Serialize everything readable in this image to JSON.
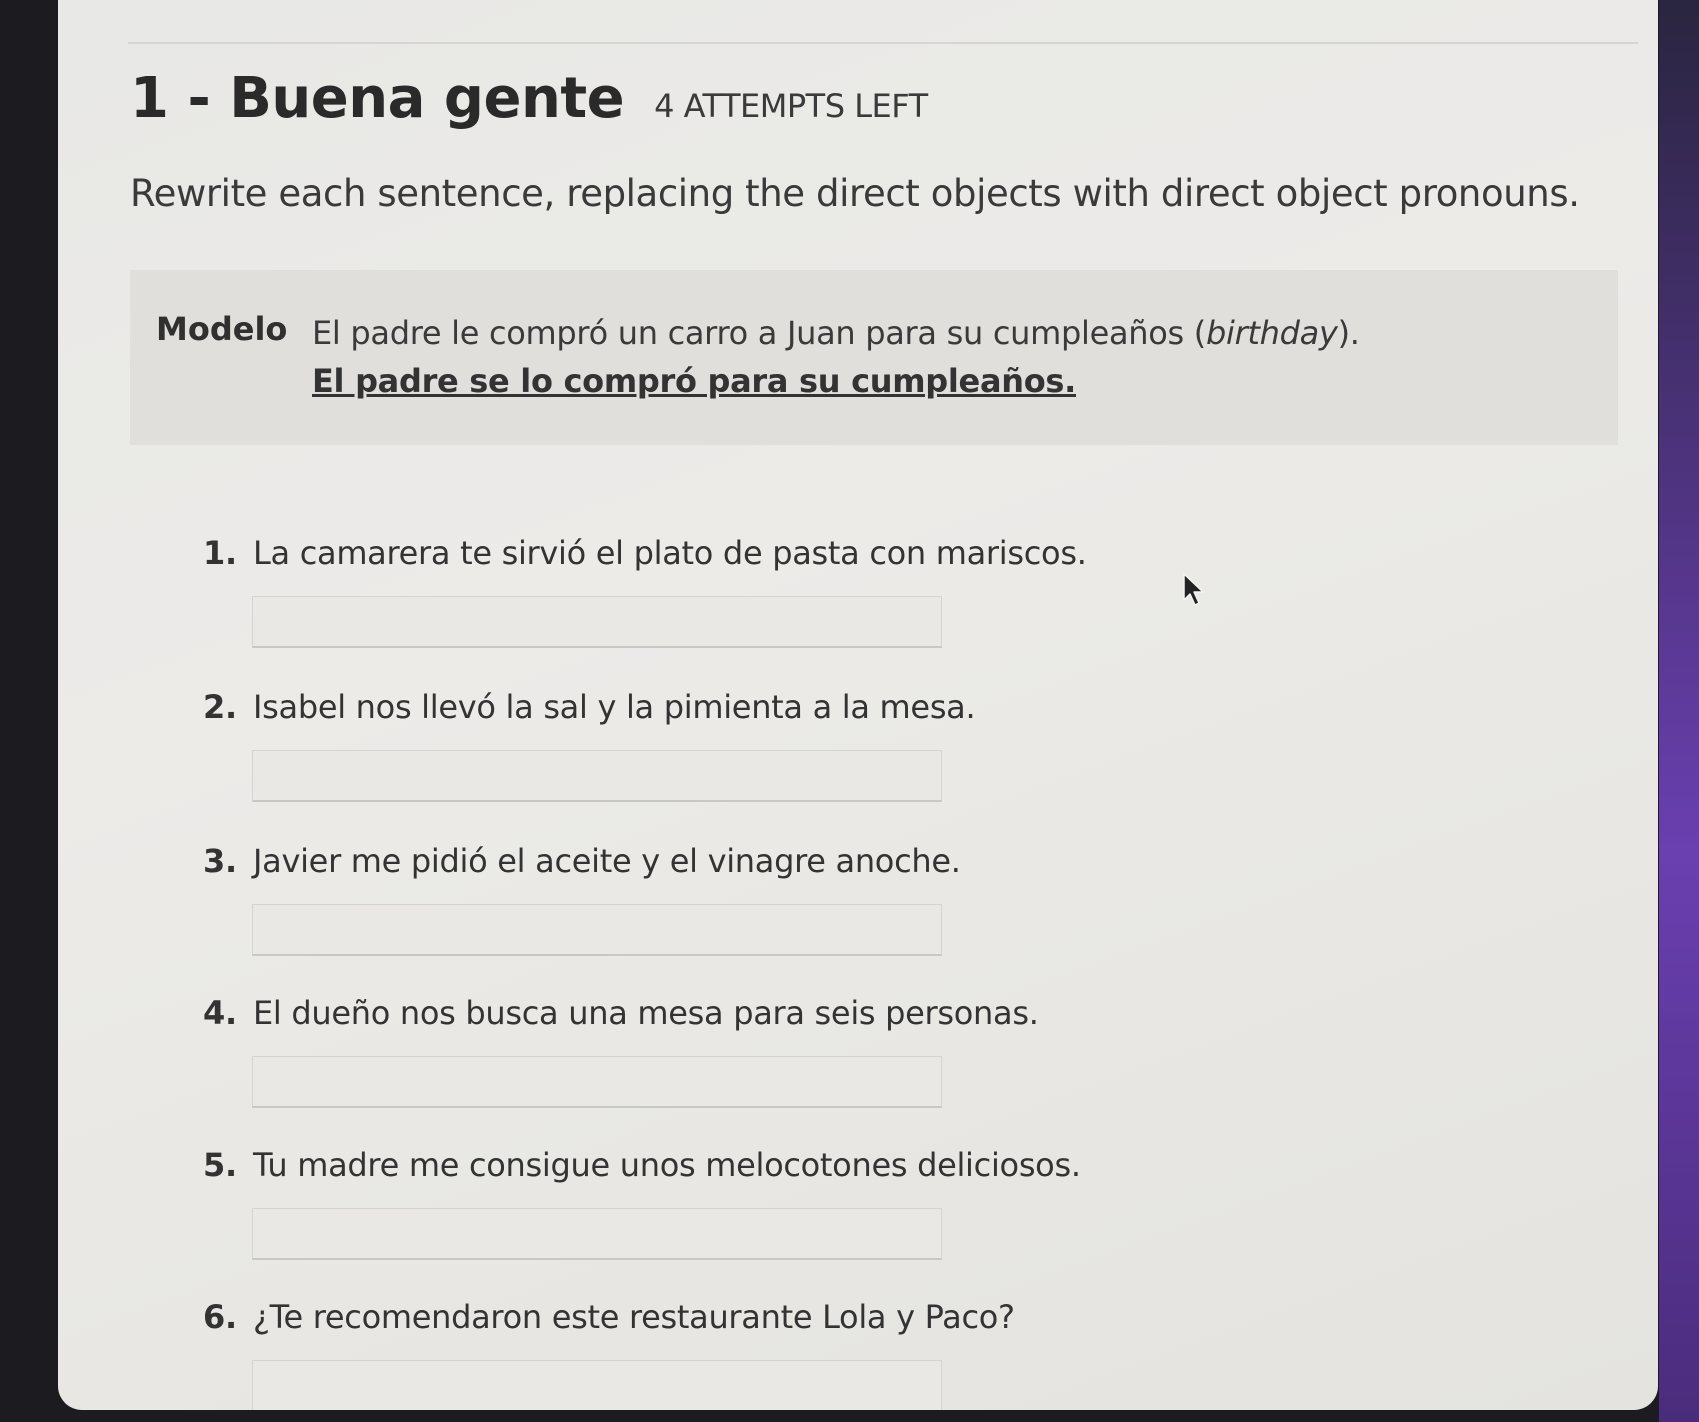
{
  "header": {
    "title": "1 - Buena gente",
    "attempts": "4 ATTEMPTS LEFT"
  },
  "instructions": "Rewrite each sentence, replacing the direct objects with direct object pronouns.",
  "model": {
    "label": "Modelo",
    "sentence_before": "El padre le compró un carro a Juan para su cumpleaños (",
    "sentence_italic": "birthday",
    "sentence_after": ").",
    "answer": "El padre se lo compró para su cumpleaños."
  },
  "questions": [
    {
      "number": "1.",
      "text": "La camarera te sirvió el plato de pasta con mariscos.",
      "value": ""
    },
    {
      "number": "2.",
      "text": "Isabel nos llevó la sal y la pimienta a la mesa.",
      "value": ""
    },
    {
      "number": "3.",
      "text": "Javier me pidió el aceite y el vinagre anoche.",
      "value": ""
    },
    {
      "number": "4.",
      "text": "El dueño nos busca una mesa para seis personas.",
      "value": ""
    },
    {
      "number": "5.",
      "text": "Tu madre me consigue unos melocotones deliciosos.",
      "value": ""
    },
    {
      "number": "6.",
      "text": "¿Te recomendaron este restaurante Lola y Paco?",
      "value": ""
    }
  ]
}
